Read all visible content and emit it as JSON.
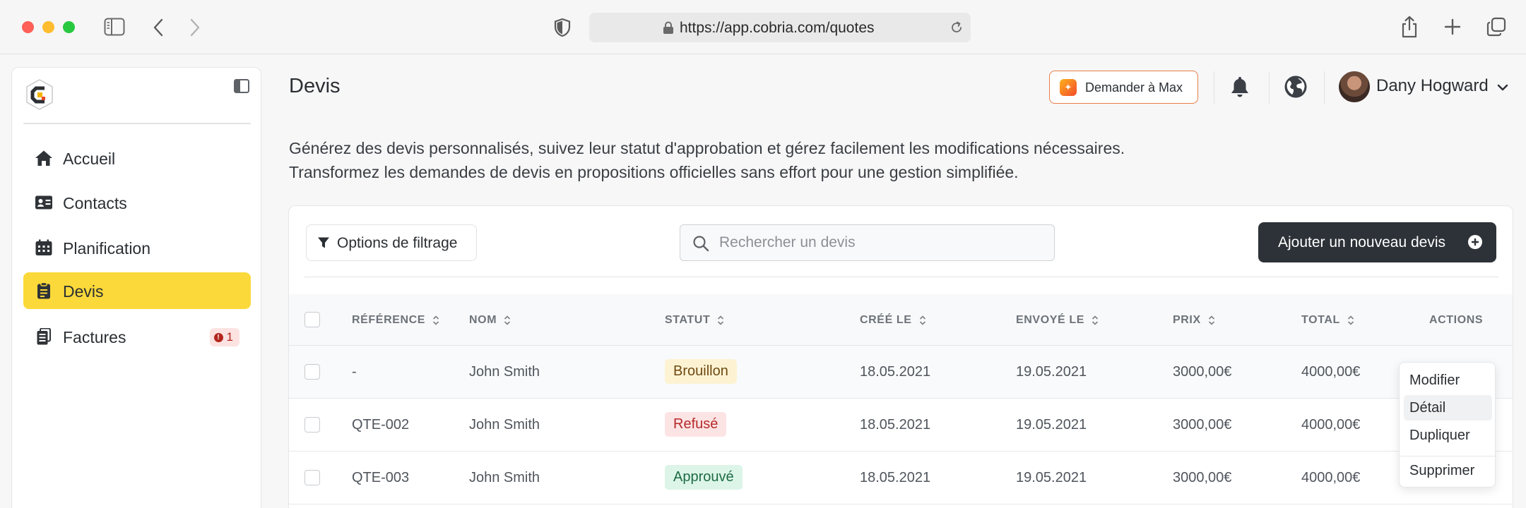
{
  "browser": {
    "url": "https://app.cobria.com/quotes"
  },
  "sidebar": {
    "items": [
      {
        "label": "Accueil",
        "icon": "home-icon"
      },
      {
        "label": "Contacts",
        "icon": "contact-card-icon"
      },
      {
        "label": "Planification",
        "icon": "calendar-icon"
      },
      {
        "label": "Devis",
        "icon": "clipboard-icon",
        "active": true
      },
      {
        "label": "Factures",
        "icon": "invoice-icon",
        "badge": "1"
      }
    ]
  },
  "header": {
    "title": "Devis",
    "ask_max_label": "Demander à Max",
    "user_name": "Dany Hogward"
  },
  "description": {
    "line1": "Générez des devis personnalisés, suivez leur statut d'approbation et gérez facilement les modifications nécessaires.",
    "line2": "Transformez les demandes de devis en propositions officielles sans effort pour une gestion simplifiée."
  },
  "toolbar": {
    "filter_label": "Options de filtrage",
    "search_placeholder": "Rechercher un devis",
    "add_label": "Ajouter un nouveau devis"
  },
  "table": {
    "columns": [
      "RÉFÉRENCE",
      "NOM",
      "STATUT",
      "CRÉÉ LE",
      "ENVOYÉ LE",
      "PRIX",
      "TOTAL",
      "ACTIONS"
    ],
    "rows": [
      {
        "ref": "-",
        "name": "John Smith",
        "status": "Brouillon",
        "created": "18.05.2021",
        "sent": "19.05.2021",
        "price": "3000,00€",
        "total": "4000,00€"
      },
      {
        "ref": "QTE-002",
        "name": "John Smith",
        "status": "Refusé",
        "created": "18.05.2021",
        "sent": "19.05.2021",
        "price": "3000,00€",
        "total": "4000,00€"
      },
      {
        "ref": "QTE-003",
        "name": "John Smith",
        "status": "Approuvé",
        "created": "18.05.2021",
        "sent": "19.05.2021",
        "price": "3000,00€",
        "total": "4000,00€"
      }
    ]
  },
  "actions_menu": {
    "items": [
      "Modifier",
      "Détail",
      "Dupliquer",
      "Supprimer"
    ],
    "highlighted": "Détail"
  },
  "colors": {
    "accent": "#fcd93a",
    "primary_button": "#2d3238",
    "ask_max_border": "#e77d45"
  }
}
